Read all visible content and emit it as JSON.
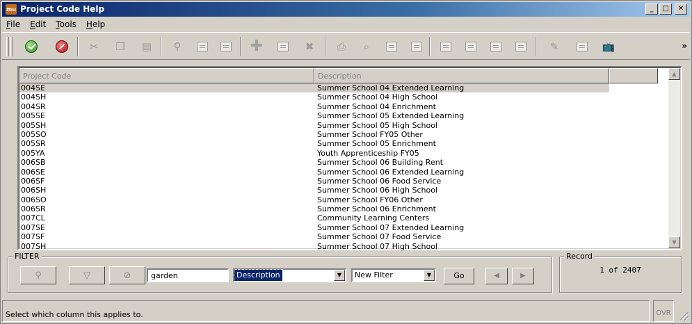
{
  "window": {
    "title": "Project Code Help",
    "icon_text": "mu"
  },
  "menu": [
    "File",
    "Edit",
    "Tools",
    "Help"
  ],
  "grid": {
    "columns": [
      "Project Code",
      "Description"
    ],
    "rows": [
      [
        "004SE",
        "Summer School 04 Extended Learning"
      ],
      [
        "004SH",
        "Summer School 04 High School"
      ],
      [
        "004SR",
        "Summer School 04 Enrichment"
      ],
      [
        "005SE",
        "Summer School 05 Extended Learning"
      ],
      [
        "005SH",
        "Summer School 05 High School"
      ],
      [
        "005SO",
        "Summer School FY05 Other"
      ],
      [
        "005SR",
        "Summer School 05 Enrichment"
      ],
      [
        "005YA",
        "Youth Apprenticeship FY05"
      ],
      [
        "006SB",
        "Summer School 06 Building Rent"
      ],
      [
        "006SE",
        "Summer School 06 Extended Learning"
      ],
      [
        "006SF",
        "Summer School 06 Food Service"
      ],
      [
        "006SH",
        "Summer School 06 High School"
      ],
      [
        "006SO",
        "Summer School FY06 Other"
      ],
      [
        "006SR",
        "Summer School 06 Enrichment"
      ],
      [
        "007CL",
        "Community Learning Centers"
      ],
      [
        "007SE",
        "Summer School 07 Extended Learning"
      ],
      [
        "007SF",
        "Summer School 07 Food Service"
      ],
      [
        "007SH",
        "Summer School 07 High School"
      ]
    ]
  },
  "filter": {
    "label": "FILTER",
    "text_value": "garden",
    "column_value": "Description",
    "filter_select_value": "New Filter",
    "go_label": "Go"
  },
  "record": {
    "label": "Record",
    "text": "1 of 2407"
  },
  "status": {
    "message": "Select which column this applies to.",
    "mode": "OVR"
  }
}
